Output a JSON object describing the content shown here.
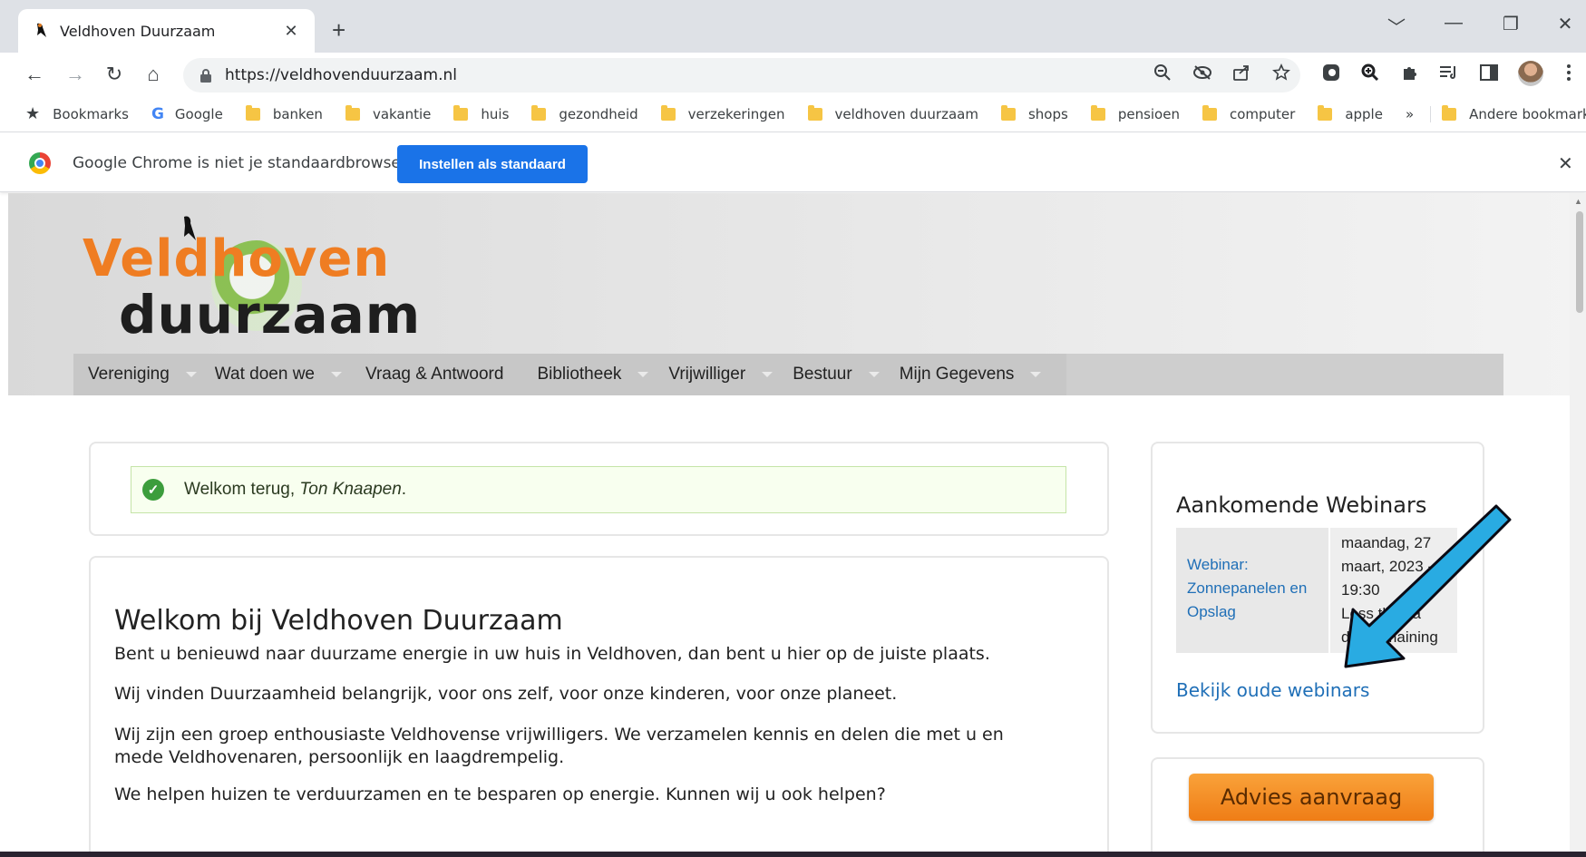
{
  "browser": {
    "tab_title": "Veldhoven Duurzaam",
    "tab_close": "✕",
    "new_tab": "+",
    "url": "https://veldhovenduurzaam.nl",
    "window_controls": [
      "﹀",
      "—",
      "❐",
      "✕"
    ],
    "nav_icons": {
      "back": "←",
      "forward": "→",
      "reload": "↻",
      "home": "⌂"
    }
  },
  "bookmarks": {
    "items": [
      {
        "label": "Bookmarks",
        "icon": "star-icon"
      },
      {
        "label": "Google",
        "icon": "google-icon"
      },
      {
        "label": "banken",
        "icon": "folder-icon"
      },
      {
        "label": "vakantie",
        "icon": "folder-icon"
      },
      {
        "label": "huis",
        "icon": "folder-icon"
      },
      {
        "label": "gezondheid",
        "icon": "folder-icon"
      },
      {
        "label": "verzekeringen",
        "icon": "folder-icon"
      },
      {
        "label": "veldhoven duurzaam",
        "icon": "folder-icon"
      },
      {
        "label": "shops",
        "icon": "folder-icon"
      },
      {
        "label": "pensioen",
        "icon": "folder-icon"
      },
      {
        "label": "computer",
        "icon": "folder-icon"
      },
      {
        "label": "apple",
        "icon": "folder-icon"
      }
    ],
    "more": "»",
    "other": "Andere bookmarks"
  },
  "infobar": {
    "text": "Google Chrome is niet je standaardbrowser",
    "button": "Instellen als standaard",
    "close": "✕"
  },
  "site": {
    "logo_line1": "Veldhoven",
    "logo_line2": "duurzaam",
    "nav": [
      "Vereniging",
      "Wat doen we",
      "Vraag & Antwoord",
      "Bibliotheek",
      "Vrijwilliger",
      "Bestuur",
      "Mijn Gegevens"
    ],
    "welcome_prefix": "Welkom terug, ",
    "welcome_name": "Ton Knaapen",
    "welcome_suffix": ".",
    "main_title": "Welkom bij Veldhoven Duurzaam",
    "paragraphs": [
      "Bent u benieuwd naar duurzame energie in uw huis in Veldhoven, dan bent u hier op de juiste plaats.",
      "Wij vinden Duurzaamheid belangrijk, voor ons zelf, voor onze kinderen, voor onze planeet.",
      "Wij zijn een groep enthousiaste Veldhovense vrijwilligers. We verzamelen kennis en delen die met u en mede Veldhovenaren, persoonlijk en laagdrempelig.",
      "We helpen huizen te verduurzamen en te besparen op energie. Kunnen wij u ook helpen?"
    ],
    "webinars": {
      "title": "Aankomende Webinars",
      "event_title": "Webinar: Zonnepanelen en Opslag",
      "event_date": "maandag, 27 maart, 2023 - 19:30",
      "event_note": "Less than a day remaining",
      "old_link": "Bekijk oude webinars"
    },
    "advies_button": "Advies aanvraag"
  },
  "colors": {
    "accent_blue": "#1a73e8",
    "logo_orange": "#ef7d22",
    "link_blue": "#1f6fb7",
    "annotation_arrow": "#29abe2"
  }
}
